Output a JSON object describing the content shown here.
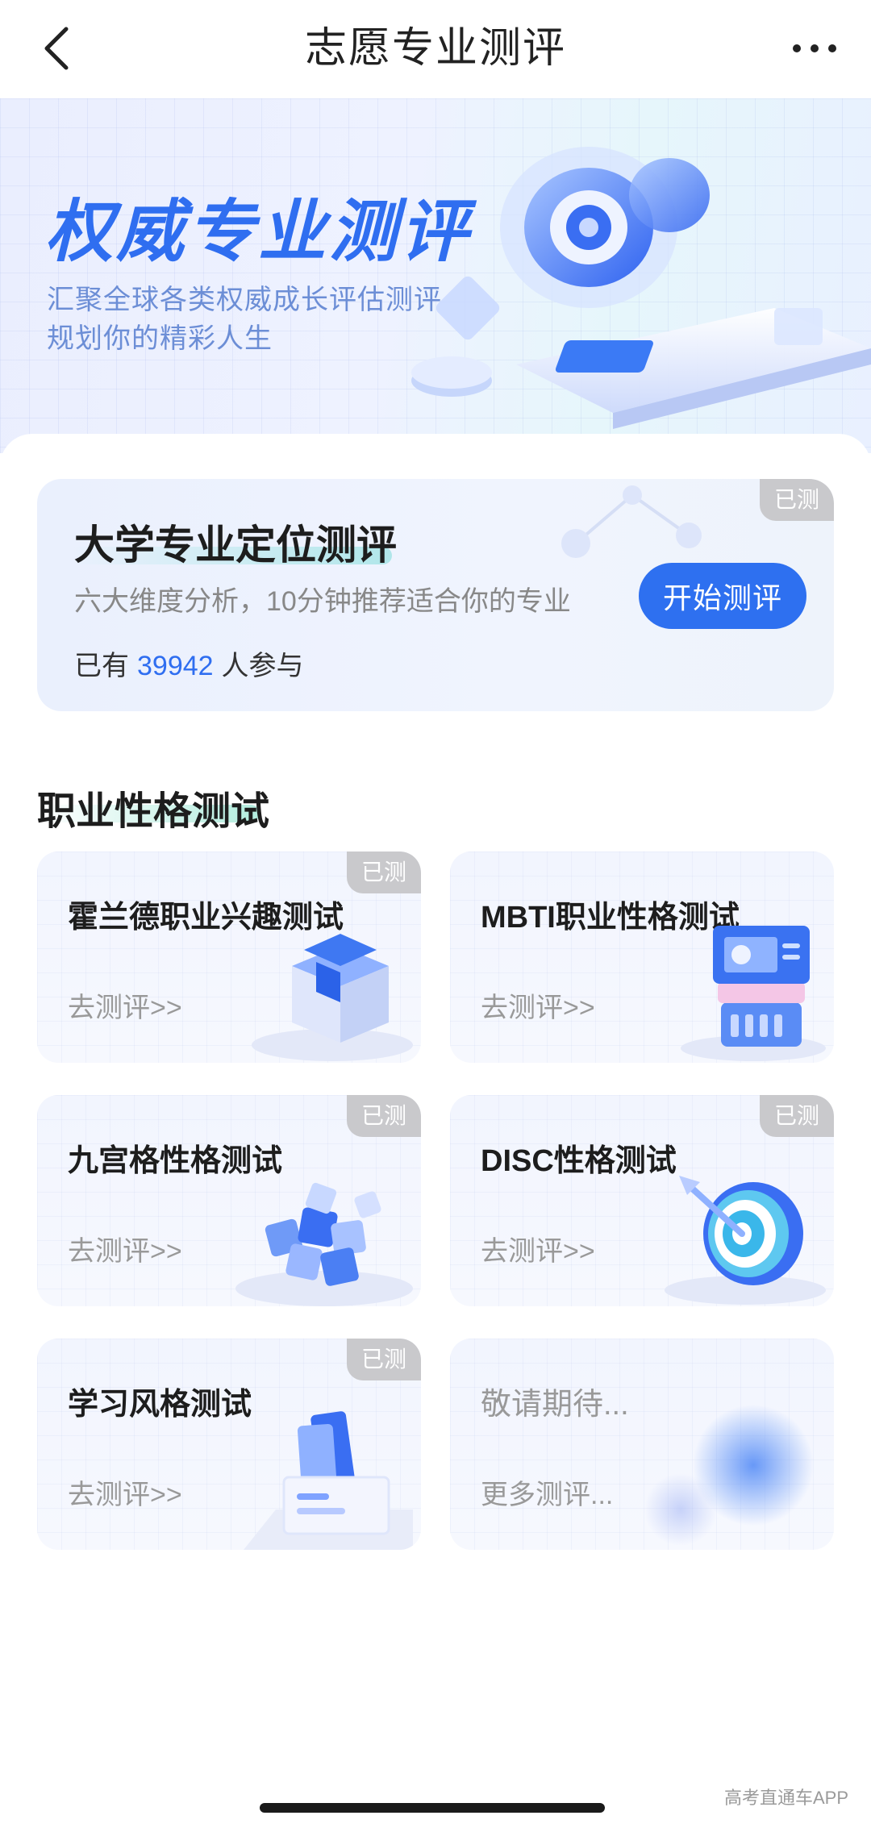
{
  "nav": {
    "title": "志愿专业测评",
    "back_icon": "chevron-left-icon",
    "more_icon": "more-horizontal-icon"
  },
  "banner": {
    "title": "权威专业测评",
    "subtitle_line1": "汇聚全球各类权威成长评估测评",
    "subtitle_line2": "规划你的精彩人生"
  },
  "featured": {
    "title": "大学专业定位测评",
    "description": "六大维度分析，10分钟推荐适合你的专业",
    "count_prefix": "已有",
    "count": "39942",
    "count_suffix": "人参与",
    "button_label": "开始测评",
    "badge": "已测"
  },
  "section": {
    "title": "职业性格测试"
  },
  "tests": [
    {
      "title": "霍兰德职业兴趣测试",
      "link": "去测评>>",
      "badge": "已测",
      "icon": "cube-icon"
    },
    {
      "title": "MBTI职业性格测试",
      "link": "去测评>>",
      "badge": "",
      "icon": "server-stack-icon"
    },
    {
      "title": "九宫格性格测试",
      "link": "去测评>>",
      "badge": "已测",
      "icon": "cube-cluster-icon"
    },
    {
      "title": "DISC性格测试",
      "link": "去测评>>",
      "badge": "已测",
      "icon": "target-icon"
    },
    {
      "title": "学习风格测试",
      "link": "去测评>>",
      "badge": "已测",
      "icon": "folder-box-icon"
    },
    {
      "title": "敬请期待...",
      "link": "更多测评...",
      "badge": "",
      "icon": "blur-orb-icon"
    }
  ],
  "watermark": "高考直通车APP",
  "colors": {
    "accent": "#2e70f0",
    "badge": "#c9c9cc",
    "banner_title": "#2f6ef0"
  }
}
